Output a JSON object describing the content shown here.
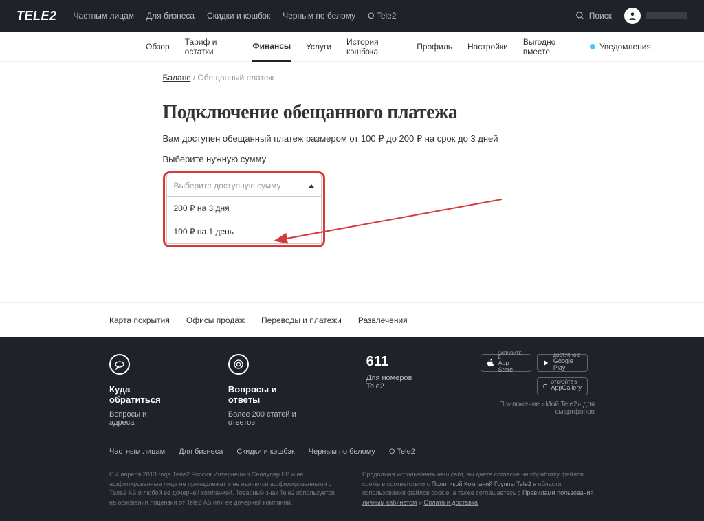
{
  "logo": "TELE2",
  "topnav": [
    "Частным лицам",
    "Для бизнеса",
    "Скидки и кэшбэк",
    "Черным по белому",
    "О Tele2"
  ],
  "search_label": "Поиск",
  "subnav": {
    "items": [
      "Обзор",
      "Тариф и остатки",
      "Финансы",
      "Услуги",
      "История кэшбэка",
      "Профиль",
      "Настройки",
      "Выгодно вместе"
    ],
    "active_index": 2,
    "notif": "Уведомления"
  },
  "breadcrumb": {
    "link": "Баланс",
    "sep": " / ",
    "current": "Обещанный платеж"
  },
  "page_title": "Подключение обещанного платежа",
  "description": "Вам доступен обещанный платеж размером от 100 ₽ до 200 ₽ на срок до 3 дней",
  "select_label": "Выберите нужную сумму",
  "dropdown": {
    "placeholder": "Выберите доступную сумму",
    "options": [
      "200 ₽ на 3 дня",
      "100 ₽ на 1 день"
    ]
  },
  "footer_links": [
    "Карта покрытия",
    "Офисы продаж",
    "Переводы и платежи",
    "Развлечения"
  ],
  "footer": {
    "col1": {
      "title": "Куда обратиться",
      "sub": "Вопросы и адреса"
    },
    "col2": {
      "title": "Вопросы и ответы",
      "sub": "Более 200 статей и ответов"
    },
    "col3": {
      "num": "611",
      "sub": "Для номеров Tele2"
    },
    "stores": {
      "appstore": {
        "small": "ЗАГРУЗИТЕ В",
        "big": "App Store"
      },
      "google": {
        "small": "ДОСТУПНО В",
        "big": "Google Play"
      },
      "huawei": {
        "small": "ОТКРОЙТЕ В",
        "big": "AppGallery"
      }
    },
    "app_txt": "Приложение «Мой Tele2» для смартфонов",
    "nav": [
      "Частным лицам",
      "Для бизнеса",
      "Скидки и кэшбэк",
      "Черным по белому",
      "О Tele2"
    ],
    "legal1": "С 4 апреля 2013 года Теле2 Россия Интернешнл Селлулар БВ и ее аффилированные лица не принадлежат и не являются аффилированными с Теле2 АБ и любой ее дочерней компанией. Товарный знак Tele2 используется на основании лицензии от Tele2 АБ или ее дочерней компании.",
    "legal2_a": "Продолжая использовать наш сайт, вы даете согласие на обработку файлов cookie в соответствии с ",
    "legal2_link1": "Политикой Компаний Группы Tele2",
    "legal2_b": " в области использования файлов cookie, а также соглашаетесь с ",
    "legal2_link2": "Правилами пользования личным кабинетом",
    "legal2_c": " и ",
    "legal2_link3": "Оплата и доставка"
  }
}
